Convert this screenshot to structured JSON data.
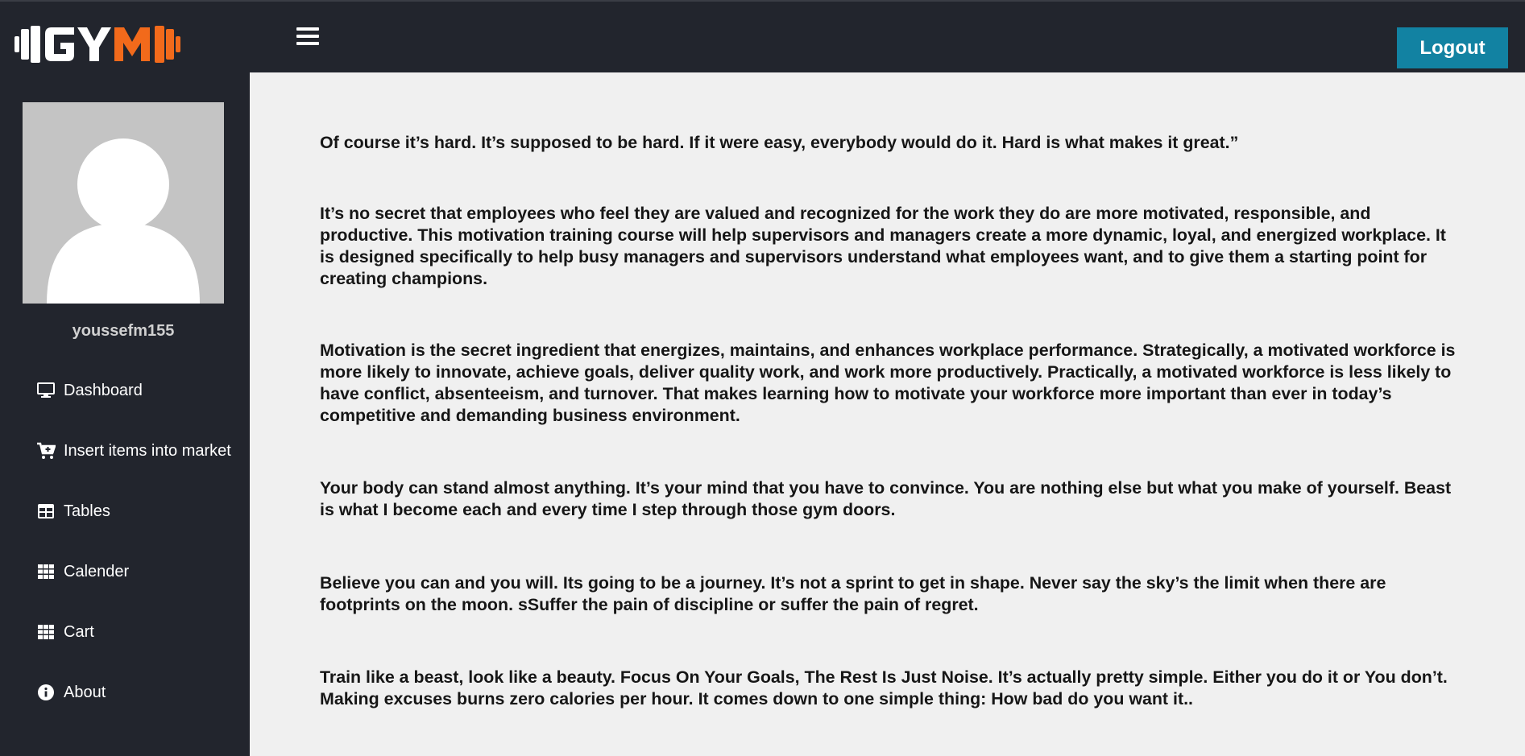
{
  "header": {
    "logo_text": "GYM",
    "menu_icon": "hamburger-icon",
    "logout_label": "Logout",
    "colors": {
      "bar": "#22252d",
      "logout": "#1282a2",
      "logo_accent": "#f26a1b"
    }
  },
  "sidebar": {
    "username": "youssefm155",
    "items": [
      {
        "label": "Dashboard",
        "icon": "monitor-icon"
      },
      {
        "label": "Insert items into market",
        "icon": "cart-plus-icon"
      },
      {
        "label": "Tables",
        "icon": "table-icon"
      },
      {
        "label": "Calender",
        "icon": "grid-icon"
      },
      {
        "label": "Cart",
        "icon": "grid-icon"
      },
      {
        "label": "About",
        "icon": "info-icon"
      }
    ]
  },
  "content": {
    "paragraphs": [
      "Of course it’s hard. It’s supposed to be hard. If it were easy, everybody would do it. Hard is what makes it great.”",
      "It’s no secret that employees who feel they are valued and recognized for the work they do are more motivated, responsible, and productive. This motivation training course will help supervisors and managers create a more dynamic, loyal, and energized workplace. It is designed specifically to help busy managers and supervisors understand what employees want, and to give them a starting point for creating champions.",
      "Motivation is the secret ingredient that energizes, maintains, and enhances workplace performance. Strategically, a motivated workforce is more likely to innovate, achieve goals, deliver quality work, and work more productively. Practically, a motivated workforce is less likely to have conflict, absenteeism, and turnover. That makes learning how to motivate your workforce more important than ever in today’s competitive and demanding business environment.",
      "Your body can stand almost anything. It’s your mind that you have to convince. You are nothing else but what you make of yourself. Beast is what I become each and every time I step through those gym doors.",
      "Believe you can and you will. Its going to be a journey. It’s not a sprint to get in shape. Never say the sky’s the limit when there are footprints on the moon. sSuffer the pain of discipline or suffer the pain of regret.",
      "Train like a beast, look like a beauty. Focus On Your Goals, The Rest Is Just Noise. It’s actually pretty simple. Either you do it or You don’t. Making excuses burns zero calories per hour. It comes down to one simple thing: How bad do you want it.."
    ]
  }
}
